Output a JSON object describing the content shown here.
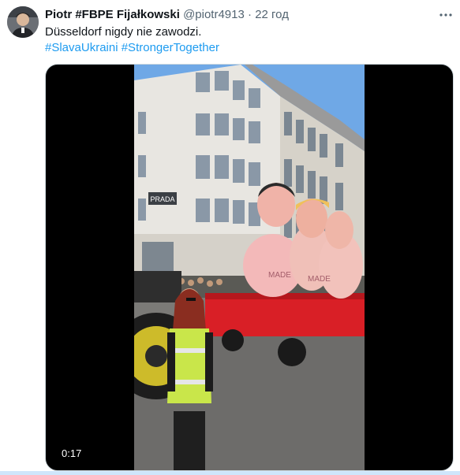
{
  "tweet": {
    "display_name": "Piotr #FBPE Fijałkowski",
    "handle": "@piotr4913",
    "separator": "·",
    "time": "22 год",
    "text": "Düsseldorf nigdy nie zawodzi.",
    "hashtags": [
      "#SlavaUkraini",
      "#StrongerTogether"
    ]
  },
  "video": {
    "timestamp": "0:17",
    "sign_text": "PRADA"
  },
  "colors": {
    "accent": "#1d9bf0",
    "secondary_text": "#536471"
  },
  "icons": {
    "more": "more-dots-icon"
  }
}
